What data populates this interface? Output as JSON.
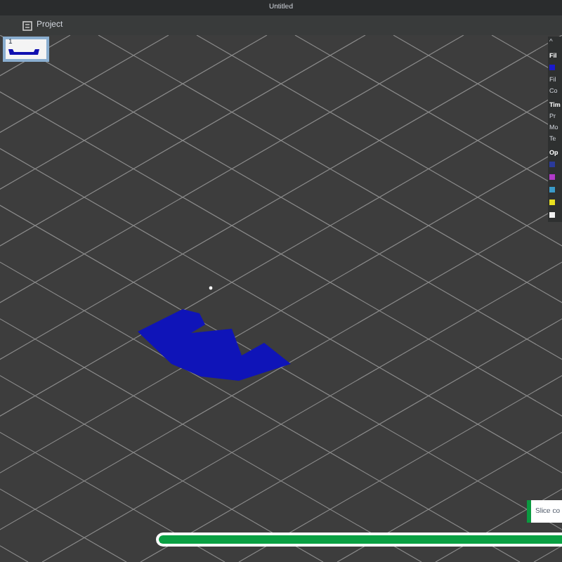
{
  "window": {
    "title": "Untitled"
  },
  "toolbar": {
    "tab": "Project"
  },
  "plate": {
    "label": "1",
    "selected": true
  },
  "side_panel": {
    "rows": [
      {
        "kind": "caret",
        "text": "^"
      },
      {
        "kind": "header",
        "text": "Fil"
      },
      {
        "kind": "swatch",
        "color": "#1a1acc"
      },
      {
        "kind": "text",
        "text": "Fil"
      },
      {
        "kind": "text",
        "text": "Co"
      },
      {
        "kind": "header",
        "text": "Tim"
      },
      {
        "kind": "text",
        "text": "Pr"
      },
      {
        "kind": "text",
        "text": "Mo"
      },
      {
        "kind": "text",
        "text": "Te"
      },
      {
        "kind": "header",
        "text": "Op"
      },
      {
        "kind": "swatch",
        "color": "#2a3a9a"
      },
      {
        "kind": "swatch",
        "color": "#b03ac8"
      },
      {
        "kind": "swatch",
        "color": "#3a9ac8"
      },
      {
        "kind": "swatch",
        "color": "#e8e020"
      },
      {
        "kind": "swatch",
        "color": "#f0f0f0"
      }
    ]
  },
  "notification": {
    "text": "Slice co"
  },
  "progress": {
    "level": 1
  }
}
